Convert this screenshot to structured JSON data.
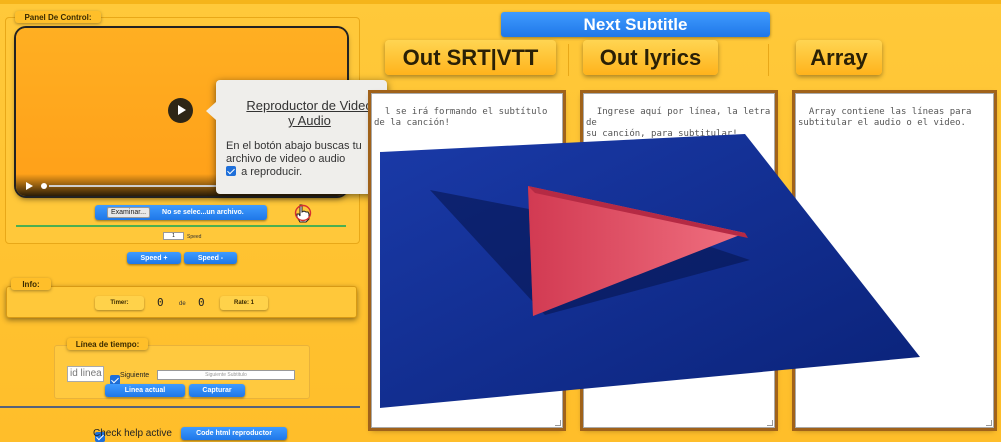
{
  "panel_control": {
    "legend": "Panel De Control:"
  },
  "player": {
    "tooltip_title": "Reproductor de Video y Audio",
    "tooltip_body_1": "En el botón abajo buscas tu archivo de video o audio",
    "tooltip_body_2": "a reproducir.",
    "file_button_label": "Examinar...",
    "file_status": "No se selec...un archivo.",
    "speed_value": "1",
    "speed_label": "Speed",
    "speed_plus": "Speed +",
    "speed_minus": "Speed -"
  },
  "info": {
    "legend": "Info:",
    "timer_label": "Timer:",
    "current": "0",
    "de": "de",
    "total": "0",
    "rate_label": "Rate: 1"
  },
  "timeline": {
    "legend": "Línea de tiempo:",
    "id_placeholder": "id linea",
    "siguiente_label": "Siguiente",
    "siguiente_placeholder": "Siguiente Subtitulo",
    "linea_actual": "Linea actual",
    "capturar": "Capturar"
  },
  "bottom": {
    "check_help_label": "Check help active",
    "code_button": "Code html reproductor"
  },
  "right": {
    "next_subtitle": "Next Subtitle",
    "tabs": [
      "Out SRT|VTT",
      "Out lyrics",
      "Array"
    ],
    "textareas": [
      "l se irá formando el subtítulo\nde la canción!",
      "Ingrese aquí por línea, la letra de\nsu canción, para subtitular!",
      "Array contiene las líneas para\nsubtitular el audio o el video."
    ]
  },
  "colors": {
    "accent_blue": "#2a86f5",
    "background": "#ffc32e",
    "overlay_plane": "#0e2a8a",
    "overlay_triangle": "#d8324a"
  }
}
